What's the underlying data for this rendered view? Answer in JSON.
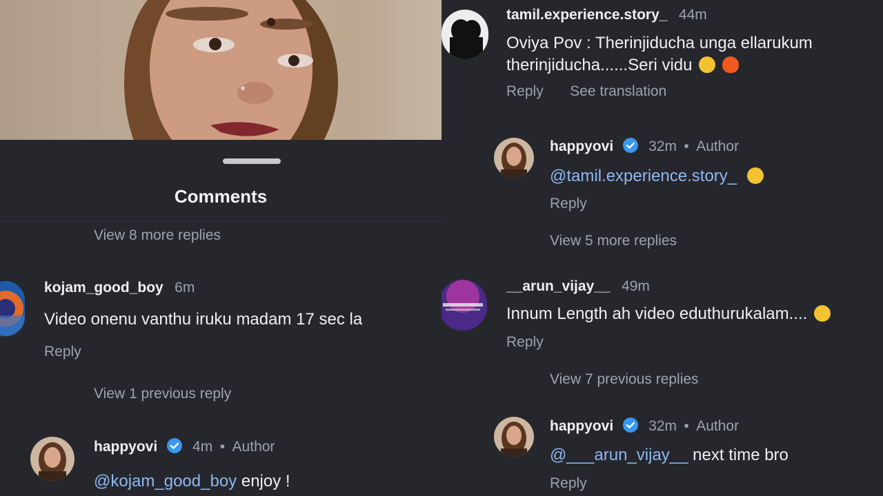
{
  "left": {
    "sheet_title": "Comments",
    "view_more_top": "View 8 more replies",
    "comment": {
      "username": "kojam_good_boy",
      "time": "6m",
      "text": "Video onenu vanthu iruku madam 17 sec la",
      "reply": "Reply"
    },
    "view_previous": "View 1 previous reply",
    "author_reply": {
      "username": "happyovi",
      "time": "4m",
      "separator": "•",
      "author_badge": "Author",
      "mention": "@kojam_good_boy",
      "text": " enjoy !"
    }
  },
  "right": {
    "comment1": {
      "username": "tamil.experience.story_",
      "time": "44m",
      "text_line1": "Oviya Pov : Therinjiducha unga ellarukum",
      "text_line2": "therinjiducha......Seri vidu",
      "emojis": [
        "laughing-emoji",
        "fire-emoji"
      ],
      "reply": "Reply",
      "see_translation": "See translation"
    },
    "author_reply1": {
      "username": "happyovi",
      "time": "32m",
      "separator": "•",
      "author_badge": "Author",
      "mention": "@tamil.experience.story_",
      "emoji": "laughing-emoji",
      "reply": "Reply"
    },
    "view_more": "View 5 more replies",
    "comment2": {
      "username": "__arun_vijay__",
      "time": "49m",
      "text": "Innum Length ah video eduthurukalam....",
      "emoji": "crying-emoji",
      "reply": "Reply"
    },
    "view_previous": "View 7 previous replies",
    "author_reply2": {
      "username": "happyovi",
      "time": "32m",
      "separator": "•",
      "author_badge": "Author",
      "mention": "@___arun_vijay__",
      "text": " next time bro",
      "reply": "Reply"
    }
  },
  "colors": {
    "background": "#25272d",
    "mention": "#8fb8f0",
    "verified": "#3897f0",
    "muted_text": "#9ea2a9"
  }
}
